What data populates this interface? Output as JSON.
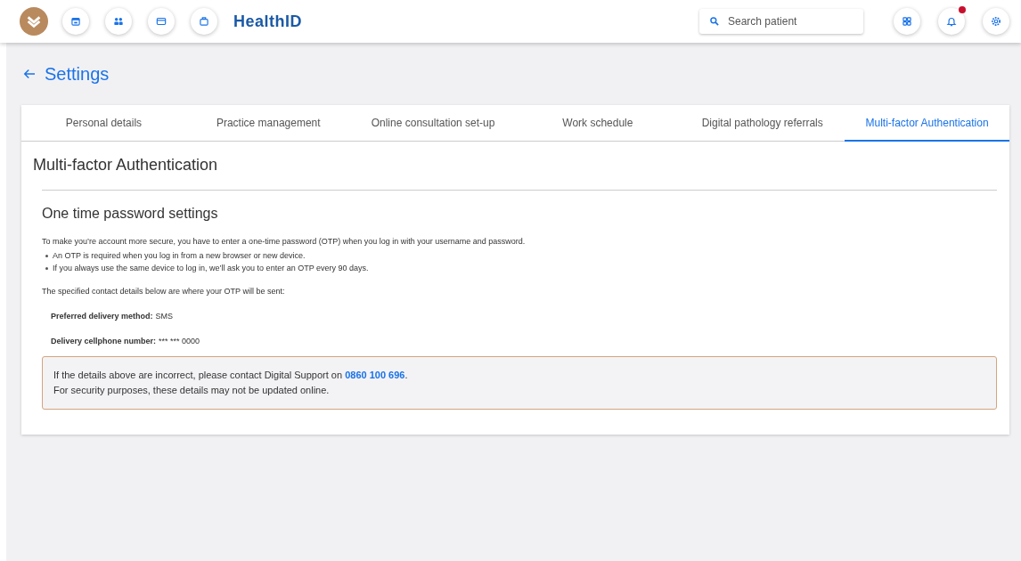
{
  "header": {
    "nav_buttons": [
      {
        "kind": "calendar"
      },
      {
        "kind": "people"
      },
      {
        "kind": "card"
      },
      {
        "kind": "briefcase"
      }
    ],
    "brand": "Health**ID**",
    "search": {
      "placeholder": "Search patient"
    },
    "actions": [
      {
        "kind": "apps",
        "badge": false
      },
      {
        "kind": "bell",
        "badge": true
      },
      {
        "kind": "settings",
        "badge": false
      }
    ]
  },
  "page_title": "Settings",
  "tabs": [
    {
      "label": "Personal details",
      "selected": false
    },
    {
      "label": "Practice management",
      "selected": false
    },
    {
      "label": "Online consultation set-up",
      "selected": false
    },
    {
      "label": "Work schedule",
      "selected": false
    },
    {
      "label": "Digital pathology referrals",
      "selected": false
    },
    {
      "label": "Multi-factor Authentication",
      "selected": true
    }
  ],
  "section_title": "Multi-factor Authentication",
  "subsection_title": "One time password settings",
  "intro": "To make you’re account more secure, you have to enter a one-time password (OTP) when you log in with your username and password.",
  "bullets": [
    "An OTP is required when you log in from a new browser or new device.",
    "If you always use the same device to log in, we’ll ask you to enter an OTP every 90 days."
  ],
  "contact_intro": "The specified contact details below are where your OTP will be sent:",
  "details": [
    {
      "label": "Preferred delivery method:",
      "value": "SMS"
    },
    {
      "label": "Delivery cellphone number:",
      "value": "*** *** 0000"
    }
  ],
  "notice": {
    "line_1_before": "If the details above are incorrect, please contact Digital Support on ",
    "phone_link": "0860 100 696",
    "line_1_after": ".",
    "line_2": "For security purposes, these details may not be updated online."
  }
}
